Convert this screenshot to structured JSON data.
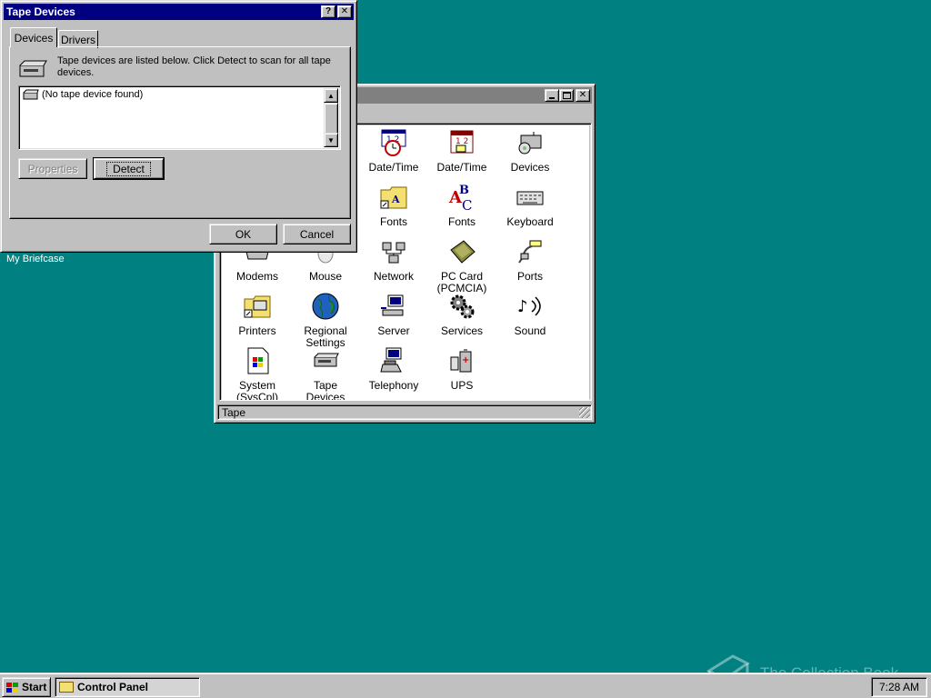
{
  "desktop": {
    "briefcase_label": "My Briefcase",
    "background": "#008080"
  },
  "control_panel": {
    "status": "Tape",
    "icons": [
      {
        "label": "Date/Time",
        "icon": "clock-calendar-icon"
      },
      {
        "label": "Date/Time",
        "icon": "calendar-icon"
      },
      {
        "label": "Devices",
        "icon": "devices-icon"
      },
      {
        "label": "Fonts",
        "icon": "fonts-folder-icon"
      },
      {
        "label": "Fonts",
        "icon": "fonts-abc-icon"
      },
      {
        "label": "Keyboard",
        "icon": "keyboard-icon"
      },
      {
        "label": "Modems",
        "icon": "modem-icon"
      },
      {
        "label": "Mouse",
        "icon": "mouse-icon"
      },
      {
        "label": "Network",
        "icon": "network-icon"
      },
      {
        "label": "PC Card (PCMCIA)",
        "icon": "pc-card-icon"
      },
      {
        "label": "Ports",
        "icon": "ports-icon"
      },
      {
        "label": "Printers",
        "icon": "printer-folder-icon"
      },
      {
        "label": "Regional Settings",
        "icon": "globe-icon"
      },
      {
        "label": "Server",
        "icon": "server-icon"
      },
      {
        "label": "Services",
        "icon": "services-gears-icon"
      },
      {
        "label": "Sound",
        "icon": "sound-icon"
      },
      {
        "label": "System (SysCpl)",
        "icon": "system-icon"
      },
      {
        "label": "Tape Devices",
        "icon": "tape-drive-icon"
      },
      {
        "label": "Telephony",
        "icon": "telephony-icon"
      },
      {
        "label": "UPS",
        "icon": "ups-battery-icon"
      }
    ]
  },
  "tape_dialog": {
    "title": "Tape Devices",
    "tabs": [
      "Devices",
      "Drivers"
    ],
    "active_tab": "Devices",
    "description": "Tape devices are listed below. Click Detect to scan for all tape devices.",
    "list_items": [
      "(No tape device found)"
    ],
    "properties_label": "Properties",
    "detect_label": "Detect",
    "ok_label": "OK",
    "cancel_label": "Cancel"
  },
  "taskbar": {
    "start_label": "Start",
    "task_label": "Control Panel",
    "clock": "7:28 AM"
  },
  "watermark": "The Collection Book"
}
